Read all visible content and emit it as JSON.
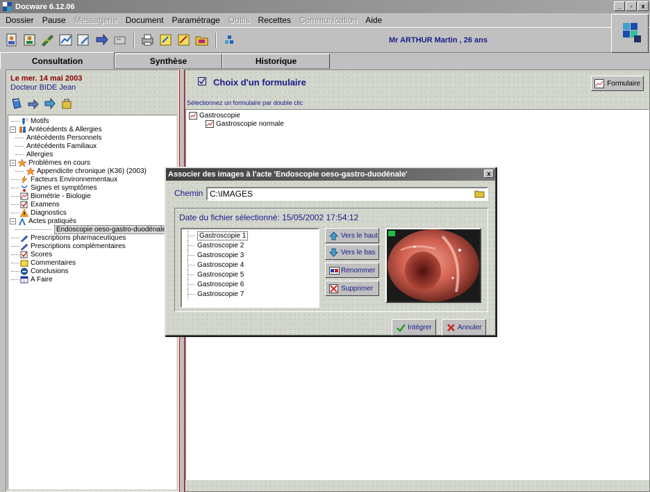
{
  "window": {
    "title": "Docware 6.12.06",
    "min": "_",
    "max": "▫",
    "close": "x"
  },
  "menu": [
    {
      "label": "Dossier",
      "enabled": true
    },
    {
      "label": "Pause",
      "enabled": true
    },
    {
      "label": "Messagerie",
      "enabled": false
    },
    {
      "label": "Document",
      "enabled": true
    },
    {
      "label": "Paramétrage",
      "enabled": true
    },
    {
      "label": "Outils",
      "enabled": false
    },
    {
      "label": "Recettes",
      "enabled": true
    },
    {
      "label": "Communication",
      "enabled": false
    },
    {
      "label": "Aide",
      "enabled": true
    }
  ],
  "patient": "Mr ARTHUR Martin , 26 ans",
  "tabs": [
    "Consultation",
    "Synthèse",
    "Historique"
  ],
  "left": {
    "date": "Le mer. 14 mai 2003",
    "doctor": "Docteur BIDE Jean",
    "tree": [
      {
        "label": "Motifs",
        "level": 0,
        "icon": "person-question-icon"
      },
      {
        "label": "Antécédents & Allergies",
        "level": 0,
        "icon": "family-icon",
        "expander": "-"
      },
      {
        "label": "Antécédents Personnels",
        "level": 1
      },
      {
        "label": "Antécédents Familiaux",
        "level": 1
      },
      {
        "label": "Allergies",
        "level": 1
      },
      {
        "label": "Problèmes en cours",
        "level": 0,
        "icon": "star-icon",
        "expander": "-"
      },
      {
        "label": "Appendicite chronique (K36) (2003)",
        "level": 1,
        "icon": "star-icon"
      },
      {
        "label": "Facteurs Environnementaux",
        "level": 0,
        "icon": "lightning-icon"
      },
      {
        "label": "Signes et symptômes",
        "level": 0,
        "icon": "symptom-icon"
      },
      {
        "label": "Biométrie - Biologie",
        "level": 0,
        "icon": "biometry-icon"
      },
      {
        "label": "Examens",
        "level": 0,
        "icon": "checkbox-icon"
      },
      {
        "label": "Diagnostics",
        "level": 0,
        "icon": "warning-icon"
      },
      {
        "label": "Actes pratiqués",
        "level": 0,
        "icon": "acts-icon",
        "expander": "-"
      },
      {
        "label": "Endoscopie oeso-gastro-duodénale",
        "level": 2,
        "selected": true
      },
      {
        "label": "Prescriptions pharmaceutiques",
        "level": 0,
        "icon": "pen-icon"
      },
      {
        "label": "Prescriptions complémentaires",
        "level": 0,
        "icon": "pen-icon"
      },
      {
        "label": "Scores",
        "level": 0,
        "icon": "checkbox-icon"
      },
      {
        "label": "Commentaires",
        "level": 0,
        "icon": "note-icon"
      },
      {
        "label": "Conclusions",
        "level": 0,
        "icon": "circle-icon"
      },
      {
        "label": "A Faire",
        "level": 0,
        "icon": "todo-icon"
      }
    ]
  },
  "right": {
    "title": "Choix d'un formulaire",
    "hint": "Sélectionnez un formulaire par double clic",
    "form_button": "Formulaire",
    "forms": [
      {
        "label": "Gastroscopie",
        "level": 0
      },
      {
        "label": "Gastroscopie normale",
        "level": 1
      }
    ]
  },
  "dialog": {
    "title": "Associer des images à l'acte 'Endoscopie oeso-gastro-duodénale'",
    "close": "x",
    "chemin_label": "Chemin",
    "chemin_value": "C:\\IMAGES",
    "date_label": "Date du fichier sélectionné: 15/05/2002 17:54:12",
    "images": [
      "Gastroscopie 1",
      "Gastroscopie 2",
      "Gastroscopie 3",
      "Gastroscopie 4",
      "Gastroscopie 5",
      "Gastroscopie 6",
      "Gastroscopie 7"
    ],
    "selected_image": 0,
    "btn_up": "Vers le haut",
    "btn_down": "Vers le bas",
    "btn_rename": "Renommer",
    "btn_delete": "Supprimer",
    "btn_ok": "Intégrer",
    "btn_cancel": "Annuler"
  }
}
